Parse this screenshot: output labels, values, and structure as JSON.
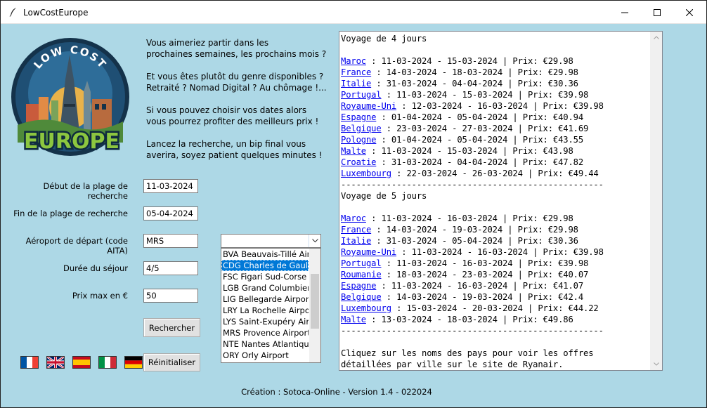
{
  "window": {
    "title": "LowCostEurope"
  },
  "logo": {
    "top_text": "LOW COST",
    "bottom_text": "EUROPE"
  },
  "intro": [
    "Vous aimeriez partir dans les\nprochaines semaines, les prochains mois ?",
    "Et vous êtes plutôt du genre disponibles ?\nRetraité ? Nomad Digital ? Au chômage !...",
    "Si vous pouvez choisir vos dates alors\nvous pourrez profiter des meilleurs prix !",
    "Lancez la recherche, un bip final vous\naverira, soyez patient quelques minutes !"
  ],
  "form": {
    "start_label": "Début de la plage de recherche",
    "start_value": "11-03-2024",
    "end_label": "Fin de la plage de recherche",
    "end_value": "05-04-2024",
    "airport_label": "Aéroport de départ (code AITA)",
    "airport_value": "MRS",
    "duration_label": "Durée du séjour",
    "duration_value": "4/5",
    "price_label": "Prix max en €",
    "price_value": "50",
    "search_button": "Rechercher",
    "reset_button": "Réinitialiser"
  },
  "airport_combo": {
    "selected": "",
    "options": [
      "BVA Beauvais-Tillé Airport",
      "CDG Charles de Gaulle",
      "FSC Figari Sud-Corse Airport",
      "LGB Grand Columbier Airport",
      "LIG Bellegarde Airport",
      "LRY La Rochelle Airport",
      "LYS Saint-Exupéry Airport",
      "MRS Provence Airport",
      "NTE Nantes Atlantique",
      "ORY Orly Airport"
    ],
    "highlighted_index": 1
  },
  "flags": [
    {
      "name": "flag-france-icon",
      "lang": "fr"
    },
    {
      "name": "flag-uk-icon",
      "lang": "en"
    },
    {
      "name": "flag-spain-icon",
      "lang": "es"
    },
    {
      "name": "flag-italy-icon",
      "lang": "it"
    },
    {
      "name": "flag-germany-icon",
      "lang": "de"
    }
  ],
  "results": {
    "sections": [
      {
        "heading": "Voyage de 4 jours",
        "rows": [
          {
            "country": "Maroc",
            "dates": "11-03-2024 - 15-03-2024",
            "price": "€29.98"
          },
          {
            "country": "France",
            "dates": "14-03-2024 - 18-03-2024",
            "price": "€29.98"
          },
          {
            "country": "Italie",
            "dates": "31-03-2024 - 04-04-2024",
            "price": "€30.36"
          },
          {
            "country": "Portugal",
            "dates": "11-03-2024 - 15-03-2024",
            "price": "€39.98"
          },
          {
            "country": "Royaume-Uni",
            "dates": "12-03-2024 - 16-03-2024",
            "price": "€39.98"
          },
          {
            "country": "Espagne",
            "dates": "01-04-2024 - 05-04-2024",
            "price": "€40.94"
          },
          {
            "country": "Belgique",
            "dates": "23-03-2024 - 27-03-2024",
            "price": "€41.69"
          },
          {
            "country": "Pologne",
            "dates": "01-04-2024 - 05-04-2024",
            "price": "€43.55"
          },
          {
            "country": "Malte",
            "dates": "11-03-2024 - 15-03-2024",
            "price": "€43.98"
          },
          {
            "country": "Croatie",
            "dates": "31-03-2024 - 04-04-2024",
            "price": "€47.82"
          },
          {
            "country": "Luxembourg",
            "dates": "22-03-2024 - 26-03-2024",
            "price": "€49.44"
          }
        ]
      },
      {
        "heading": "Voyage de 5 jours",
        "rows": [
          {
            "country": "Maroc",
            "dates": "11-03-2024 - 16-03-2024",
            "price": "€29.98"
          },
          {
            "country": "France",
            "dates": "14-03-2024 - 19-03-2024",
            "price": "€29.98"
          },
          {
            "country": "Italie",
            "dates": "31-03-2024 - 05-04-2024",
            "price": "€30.36"
          },
          {
            "country": "Royaume-Uni",
            "dates": "11-03-2024 - 16-03-2024",
            "price": "€39.98"
          },
          {
            "country": "Portugal",
            "dates": "11-03-2024 - 16-03-2024",
            "price": "€39.98"
          },
          {
            "country": "Roumanie",
            "dates": "18-03-2024 - 23-03-2024",
            "price": "€40.07"
          },
          {
            "country": "Espagne",
            "dates": "11-03-2024 - 16-03-2024",
            "price": "€41.07"
          },
          {
            "country": "Belgique",
            "dates": "14-03-2024 - 19-03-2024",
            "price": "€42.4"
          },
          {
            "country": "Luxembourg",
            "dates": "15-03-2024 - 20-03-2024",
            "price": "€44.22"
          },
          {
            "country": "Malte",
            "dates": "13-03-2024 - 18-03-2024",
            "price": "€49.86"
          }
        ]
      }
    ],
    "separator": "----------------------------------------------------",
    "price_prefix": "Prix: ",
    "footer_note": "Cliquez sur les noms des pays pour voir les offres\ndétaillées par ville sur le site de Ryanair."
  },
  "footer": "Création : Sotoca-Online - Version 1.4 - 022024"
}
